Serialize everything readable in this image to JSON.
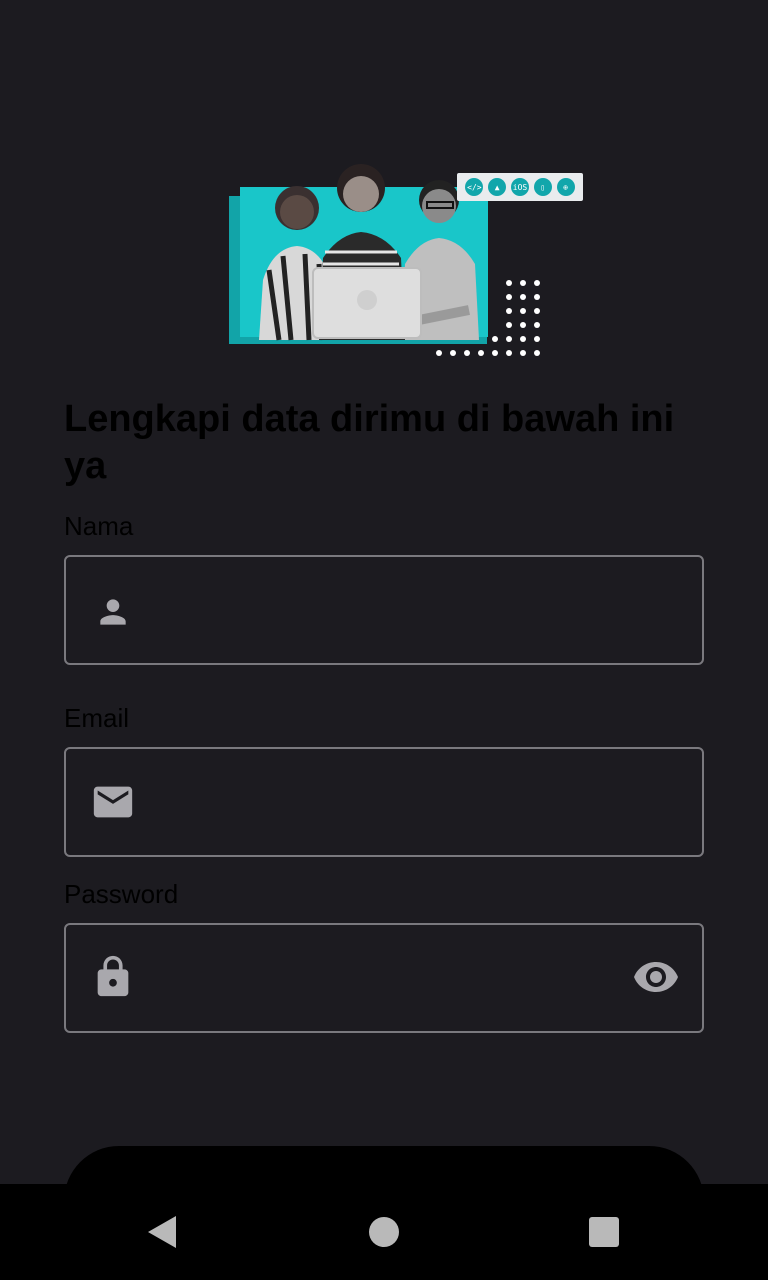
{
  "hero": {
    "platform_tags": [
      "</>",
      "▲",
      "iOS",
      "▯",
      "⊕"
    ]
  },
  "heading": "Lengkapi data dirimu di bawah ini ya",
  "form": {
    "name": {
      "label": "Nama",
      "value": "",
      "placeholder": "",
      "icon": "person-icon"
    },
    "email": {
      "label": "Email",
      "value": "",
      "placeholder": "",
      "icon": "mail-icon"
    },
    "password": {
      "label": "Password",
      "value": "",
      "placeholder": "",
      "icon": "lock-icon",
      "toggle_icon": "eye-icon"
    }
  },
  "submit": {
    "label": ""
  },
  "nav": {
    "back": "back-icon",
    "home": "home-icon",
    "recents": "recents-icon"
  },
  "colors": {
    "background": "#1c1b20",
    "accent": "#19c6c9",
    "field_border": "#7a797e",
    "icon": "#a9a8ad"
  }
}
